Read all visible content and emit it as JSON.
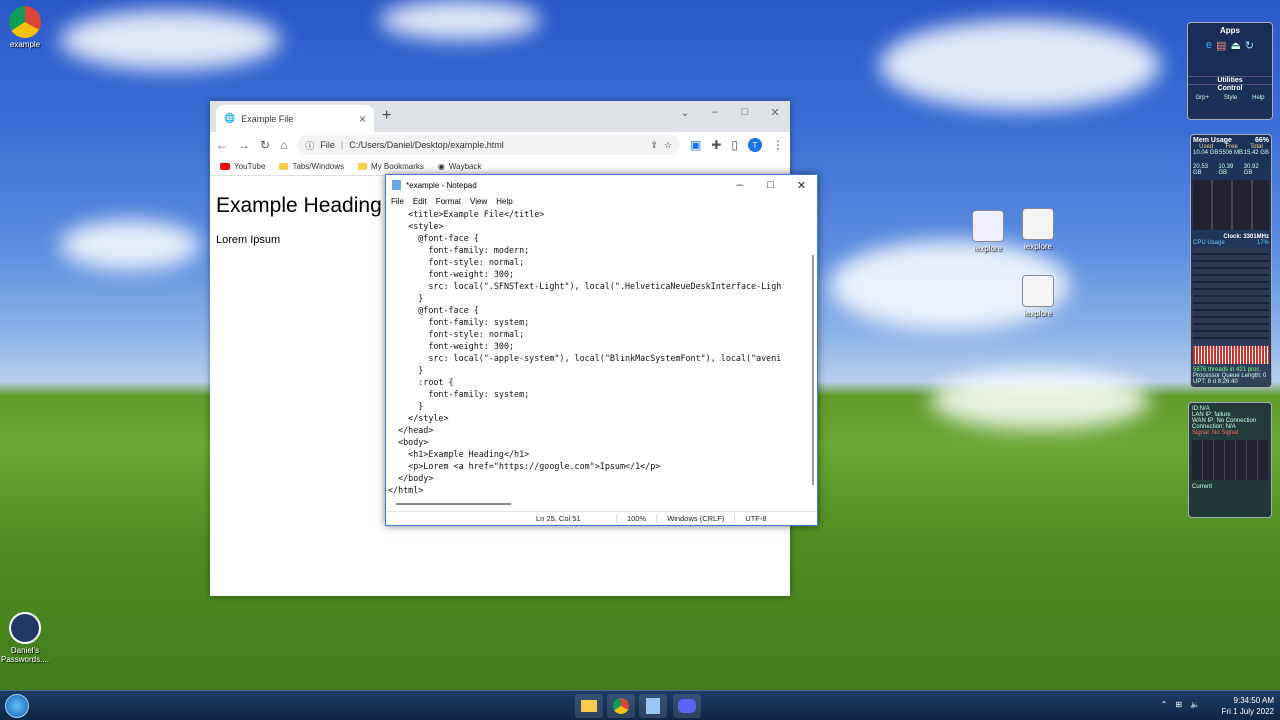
{
  "desktop": {
    "icons": [
      {
        "label": "example"
      },
      {
        "label": "iexplore"
      },
      {
        "label": "iexplore"
      },
      {
        "label": "iexplore"
      },
      {
        "label": "Daniel's Passwords...."
      }
    ]
  },
  "chrome": {
    "tab_title": "Example File",
    "url_prefix": "File",
    "url": "C:/Users/Daniel/Desktop/example.html",
    "bookmarks": [
      "YouTube",
      "Tabs/Windows",
      "My Bookmarks",
      "Wayback"
    ],
    "page_heading": "Example Heading",
    "page_text": "Lorem Ipsum"
  },
  "notepad": {
    "title": "*example - Notepad",
    "menu": [
      "File",
      "Edit",
      "Format",
      "View",
      "Help"
    ],
    "lines": [
      "    <title>Example File</title>",
      "    <style>",
      "      @font-face {",
      "        font-family: modern;",
      "        font-style: normal;",
      "        font-weight: 300;",
      "        src: local(\".SFNSText-Light\"), local(\".HelveticaNeueDeskInterface-Ligh",
      "      }",
      "      @font-face {",
      "        font-family: system;",
      "        font-style: normal;",
      "        font-weight: 300;",
      "        src: local(\"-apple-system\"), local(\"BlinkMacSystemFont\"), local(\"aveni",
      "      }",
      "      :root {",
      "        font-family: system;",
      "      }",
      "    </style>",
      "  </head>",
      "  <body>",
      "    <h1>Example Heading</h1>",
      "    <p>Lorem <a href=\"https://google.com\">Ipsum</1</p>",
      "  </body>",
      "</html>"
    ],
    "status": {
      "position": "Ln 25, Col 51",
      "zoom": "100%",
      "line_ending": "Windows (CRLF)",
      "encoding": "UTF-8"
    }
  },
  "gadgets": {
    "apps_title": "Apps",
    "utilities": "Utilities",
    "control": "Control",
    "apps_links": [
      "Grp+",
      "Style",
      "Help"
    ],
    "mem_title": "Mem Usage",
    "mem_percent": "66%",
    "mem_headers": [
      "Used",
      "Free",
      "Total"
    ],
    "mem_row1": [
      "10.04 GB",
      "5506 MB",
      "15.42 GB"
    ],
    "mem_row2": [
      "20.53 GB",
      "10.39 GB",
      "30.92 GB"
    ],
    "clock_speed": "Clock: 3301MHz",
    "cpu_usage": "CPU Usage",
    "cpu_percent": "17%",
    "threads": "5876 threads in 421 proc.",
    "queue": "Processor Queue Length: 0",
    "uptime": "UPT: 8 d 8:26:40",
    "net_ip": "ID:N/A",
    "net_lan": "LAN IP: failure",
    "net_wan": "WAN IP: No Connection",
    "net_conn": "Connection: N/A",
    "net_signal": "Signal: No Signal",
    "net_current": "Current"
  },
  "taskbar": {
    "time": "9:34:50 AM",
    "date": "Fri 1 July 2022"
  }
}
